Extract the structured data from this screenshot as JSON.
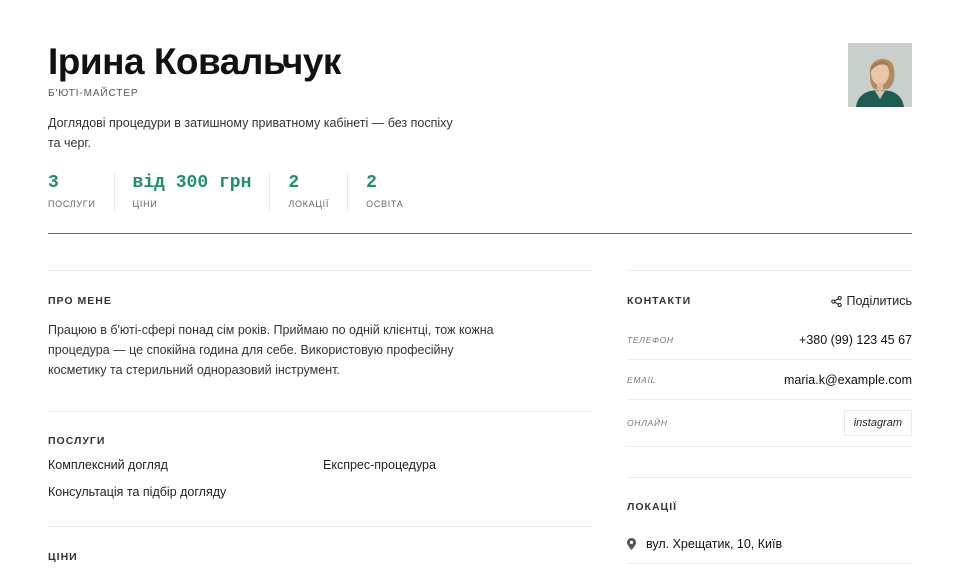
{
  "profile": {
    "name": "Ірина Ковальчук",
    "role": "Б'ЮТІ-МАЙСТЕР",
    "tagline": "Доглядові процедури в затишному приватному кабінеті — без поспіху та черг.",
    "photo": "avatar"
  },
  "stats": [
    {
      "value": "3",
      "label": "ПОСЛУГИ"
    },
    {
      "value": "від 300 грн",
      "label": "ЦІНИ"
    },
    {
      "value": "2",
      "label": "ЛОКАЦІЇ"
    },
    {
      "value": "2",
      "label": "ОСВІТА"
    }
  ],
  "about": {
    "title": "ПРО МЕНЕ",
    "text": "Працюю в б'юті-сфері понад сім років. Приймаю по одній клієнтці, тож кожна процедура — це спокійна година для себе. Використовую професійну косметику та стерильний одноразовий інструмент."
  },
  "services": {
    "title": "ПОСЛУГИ",
    "items": [
      "Комплексний догляд",
      "Експрес-процедура",
      "Консультація та підбір догляду"
    ]
  },
  "prices": {
    "title": "ЦІНИ"
  },
  "contacts": {
    "title": "КОНТАКТИ",
    "share_label": "Поділитись",
    "phone_label": "ТЕЛЕФОН",
    "phone": "+380 (99) 123 45 67",
    "email_label": "EMAIL",
    "email": "maria.k@example.com",
    "online_label": "ОНЛАЙН",
    "instagram": "instagram"
  },
  "locations": {
    "title": "ЛОКАЦІЇ",
    "items": [
      "вул. Хрещатик, 10, Київ"
    ]
  },
  "colors": {
    "accent": "#1f8f6d",
    "text": "#1a1a1a",
    "muted": "#666666",
    "rule": "#e3eeea"
  }
}
